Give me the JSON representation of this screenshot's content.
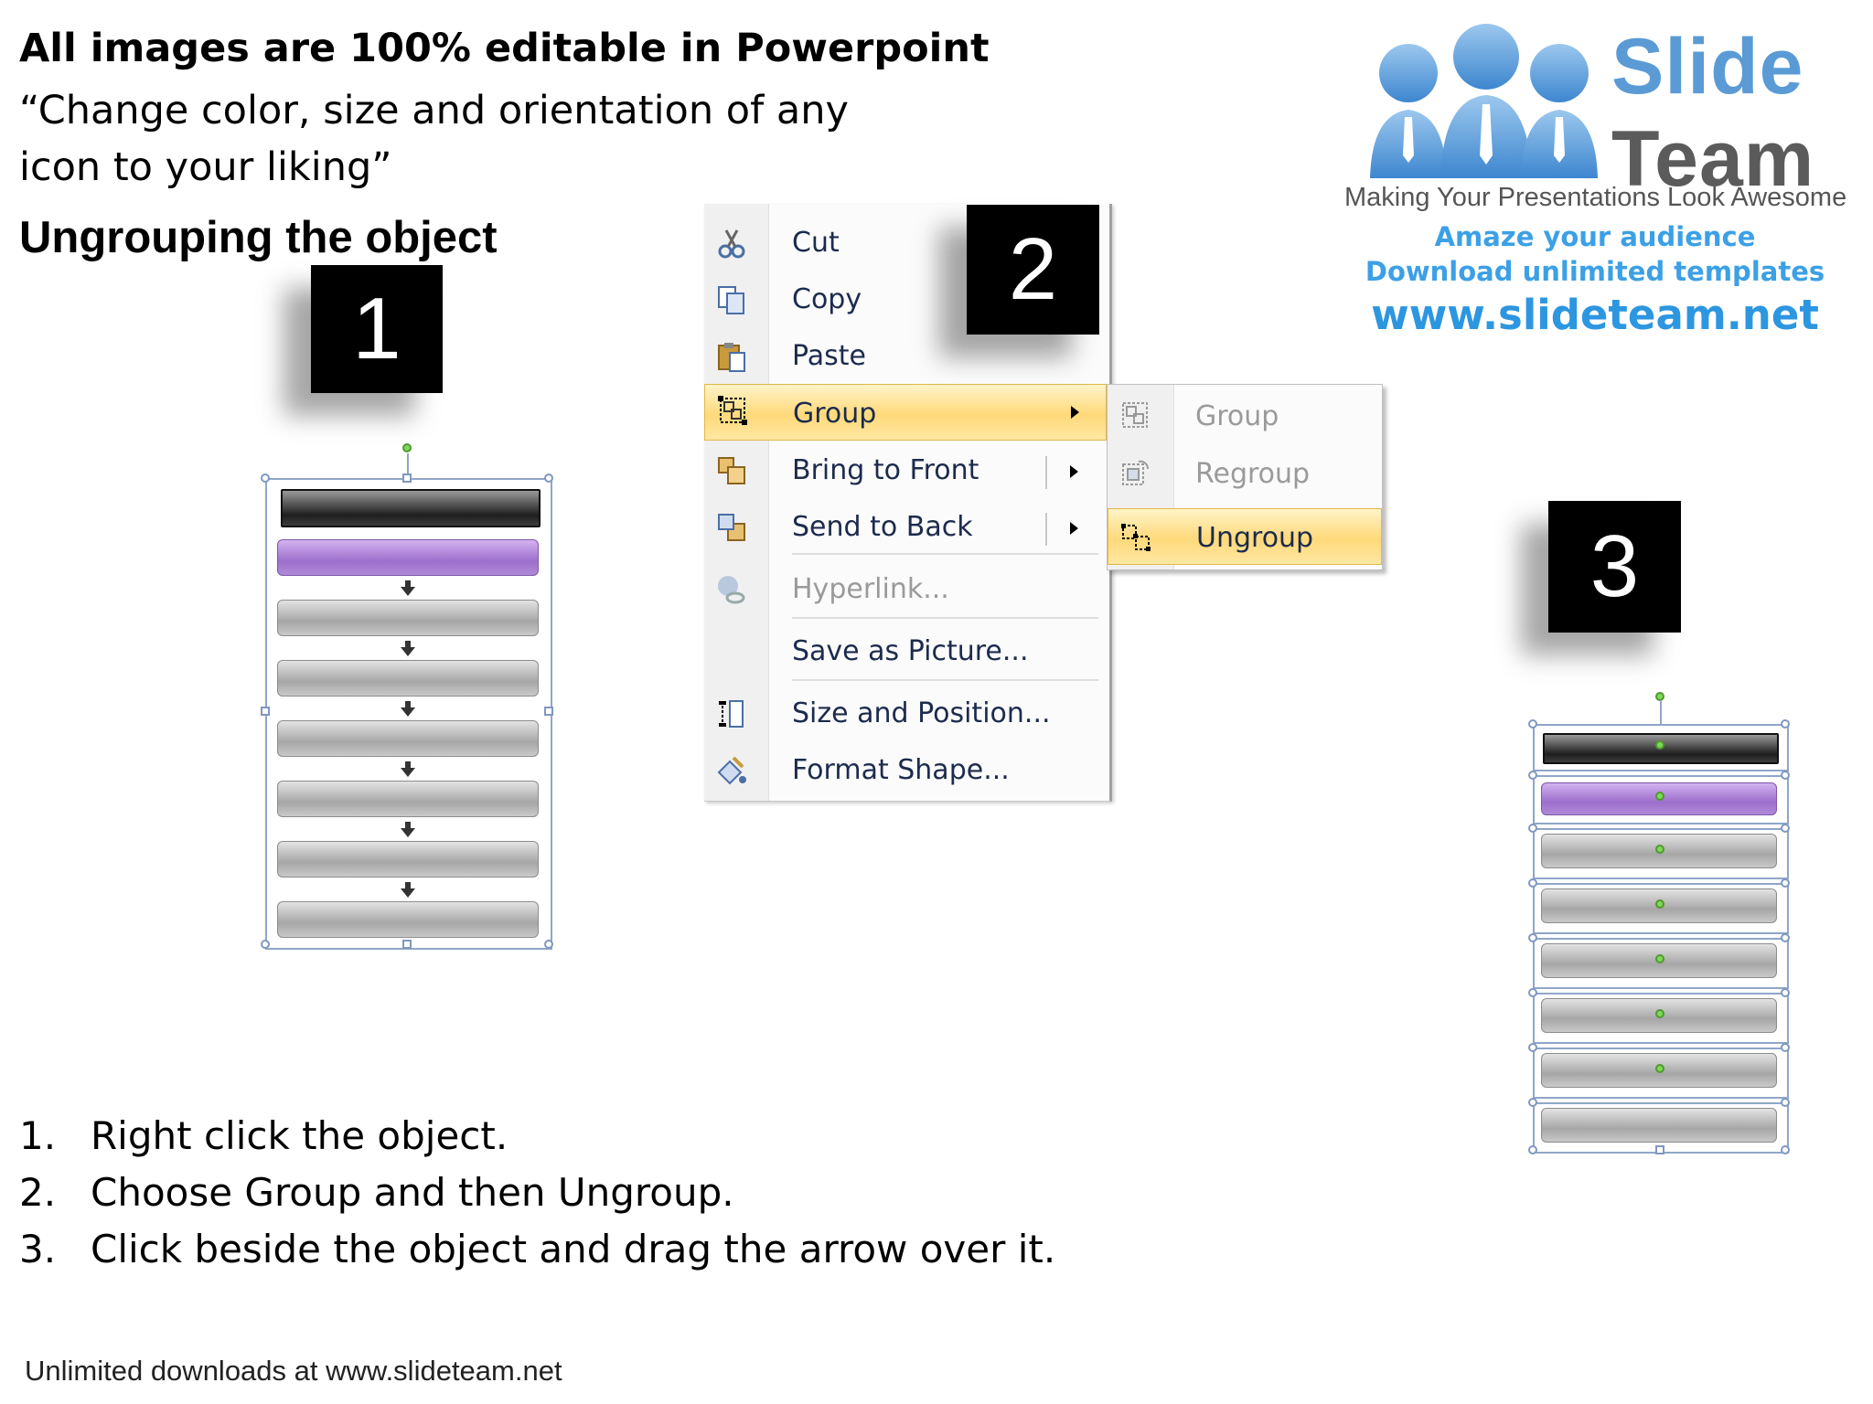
{
  "header": {
    "bold_line": "All images are 100% editable in Powerpoint",
    "quote_line": "“Change color, size and orientation of any icon to your liking”",
    "subtitle": "Ungrouping the object"
  },
  "steps": {
    "one": "1",
    "two": "2",
    "three": "3"
  },
  "context_menu": {
    "items": [
      {
        "label": "Cut",
        "icon": "scissors-icon"
      },
      {
        "label": "Copy",
        "icon": "copy-icon"
      },
      {
        "label": "Paste",
        "icon": "paste-icon"
      },
      {
        "label": "Group",
        "icon": "group-icon",
        "highlighted": true,
        "has_submenu": true
      },
      {
        "label": "Bring to Front",
        "icon": "bring-to-front-icon",
        "has_submenu": true
      },
      {
        "label": "Send to Back",
        "icon": "send-to-back-icon",
        "has_submenu": true
      },
      {
        "label": "Hyperlink...",
        "icon": "hyperlink-icon",
        "disabled": true
      },
      {
        "label": "Save as Picture...",
        "icon": ""
      },
      {
        "label": "Size and Position...",
        "icon": "size-position-icon"
      },
      {
        "label": "Format Shape...",
        "icon": "format-shape-icon"
      }
    ]
  },
  "submenu": {
    "items": [
      {
        "label": "Group",
        "icon": "group-icon",
        "disabled": true
      },
      {
        "label": "Regroup",
        "icon": "regroup-icon",
        "disabled": true
      },
      {
        "label": "Ungroup",
        "icon": "ungroup-icon",
        "highlighted": true
      }
    ]
  },
  "logo": {
    "word1": "Slide",
    "word2": "Team",
    "tagline": "Making Your Presentations Look Awesome",
    "line1": "Amaze your audience",
    "line2": "Download unlimited templates",
    "url": "www.slideteam.net"
  },
  "instructions": [
    {
      "num": "1.",
      "text": "Right click the object."
    },
    {
      "num": "2.",
      "text": "Choose Group and then Ungroup."
    },
    {
      "num": "3.",
      "text": "Click beside the object and drag the arrow over it."
    }
  ],
  "footer": "Unlimited downloads at www.slideteam.net",
  "colors": {
    "menu_highlight": "#ffd97a",
    "logo_blue": "#5b9bd5",
    "logo_grey": "#5b5b5b",
    "purple_bar": "#9d6fcc"
  }
}
